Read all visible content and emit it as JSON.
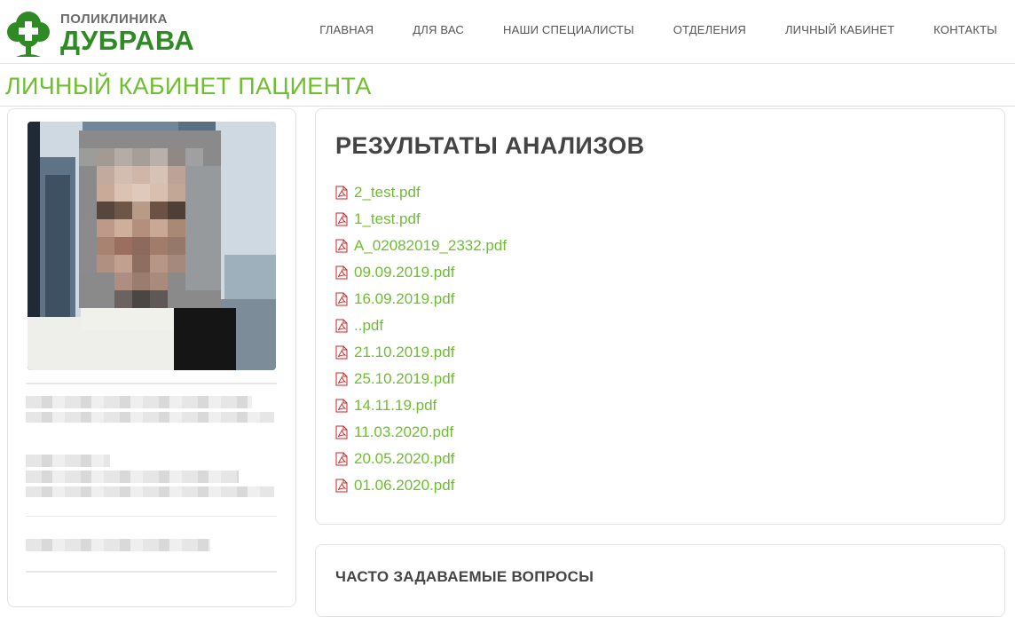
{
  "logo": {
    "subtitle": "ПОЛИКЛИНИКА",
    "name": "ДУБРАВА"
  },
  "nav": [
    {
      "label": "ГЛАВНАЯ"
    },
    {
      "label": "ДЛЯ ВАС"
    },
    {
      "label": "НАШИ СПЕЦИАЛИСТЫ"
    },
    {
      "label": "ОТДЕЛЕНИЯ"
    },
    {
      "label": "ЛИЧНЫЙ КАБИНЕТ"
    },
    {
      "label": "КОНТАКТЫ"
    }
  ],
  "page": {
    "title": "ЛИЧНЫЙ КАБИНЕТ ПАЦИЕНТА"
  },
  "results": {
    "title": "РЕЗУЛЬТАТЫ АНАЛИЗОВ",
    "files": [
      {
        "name": "2_test.pdf"
      },
      {
        "name": "1_test.pdf"
      },
      {
        "name": "A_02082019_2332.pdf"
      },
      {
        "name": "09.09.2019.pdf"
      },
      {
        "name": "16.09.2019.pdf"
      },
      {
        "name": "..pdf"
      },
      {
        "name": "21.10.2019.pdf"
      },
      {
        "name": "25.10.2019.pdf"
      },
      {
        "name": "14.11.19.pdf"
      },
      {
        "name": "11.03.2020.pdf"
      },
      {
        "name": "20.05.2020.pdf"
      },
      {
        "name": "01.06.2020.pdf"
      }
    ]
  },
  "faq": {
    "title": "ЧАСТО ЗАДАВАЕМЫЕ ВОПРОСЫ"
  },
  "colors": {
    "accent": "#6dbf2e",
    "brand": "#2e8b23",
    "heading": "#444444"
  },
  "icons": {
    "logo": "tree-cross-icon",
    "file": "pdf-icon"
  }
}
